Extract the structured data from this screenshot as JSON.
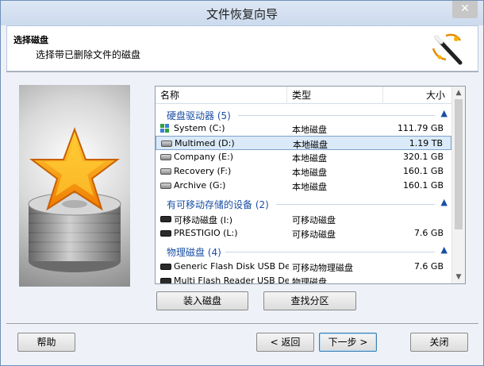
{
  "window": {
    "title": "文件恢复向导",
    "close_glyph": "✕"
  },
  "header": {
    "title": "选择磁盘",
    "subtitle": "选择带已删除文件的磁盘"
  },
  "list": {
    "columns": [
      "名称",
      "类型",
      "大小"
    ],
    "groups": [
      {
        "label": "硬盘驱动器 (5)",
        "rows": [
          {
            "name": "System (C:)",
            "type": "本地磁盘",
            "size": "111.79 GB",
            "icon": "windows-drive-icon",
            "selected": false
          },
          {
            "name": "Multimed (D:)",
            "type": "本地磁盘",
            "size": "1.19 TB",
            "icon": "hard-drive-icon",
            "selected": true
          },
          {
            "name": "Company (E:)",
            "type": "本地磁盘",
            "size": "320.1 GB",
            "icon": "hard-drive-icon",
            "selected": false
          },
          {
            "name": "Recovery (F:)",
            "type": "本地磁盘",
            "size": "160.1 GB",
            "icon": "hard-drive-icon",
            "selected": false
          },
          {
            "name": "Archive (G:)",
            "type": "本地磁盘",
            "size": "160.1 GB",
            "icon": "hard-drive-icon",
            "selected": false
          }
        ]
      },
      {
        "label": "有可移动存储的设备 (2)",
        "rows": [
          {
            "name": "可移动磁盘 (I:)",
            "type": "可移动磁盘",
            "size": "",
            "icon": "usb-drive-icon",
            "selected": false
          },
          {
            "name": "PRESTIGIO (L:)",
            "type": "可移动磁盘",
            "size": "7.6 GB",
            "icon": "usb-drive-icon",
            "selected": false
          }
        ]
      },
      {
        "label": "物理磁盘 (4)",
        "rows": [
          {
            "name": "Generic Flash Disk USB De...",
            "type": "可移动物理磁盘",
            "size": "7.6 GB",
            "icon": "usb-drive-icon",
            "selected": false
          },
          {
            "name": "Multi Flash Reader USB De...",
            "type": "物理磁盘",
            "size": "",
            "icon": "usb-drive-icon",
            "selected": false
          }
        ]
      }
    ]
  },
  "buttons": {
    "mount": "装入磁盘",
    "find_partitions": "查找分区",
    "help": "帮助",
    "back": "< 返回",
    "next": "下一步 >",
    "close": "关闭"
  },
  "colors": {
    "accent": "#1a4ea3",
    "selection": "#dbeaf8",
    "window_bg": "#eef2f8"
  }
}
